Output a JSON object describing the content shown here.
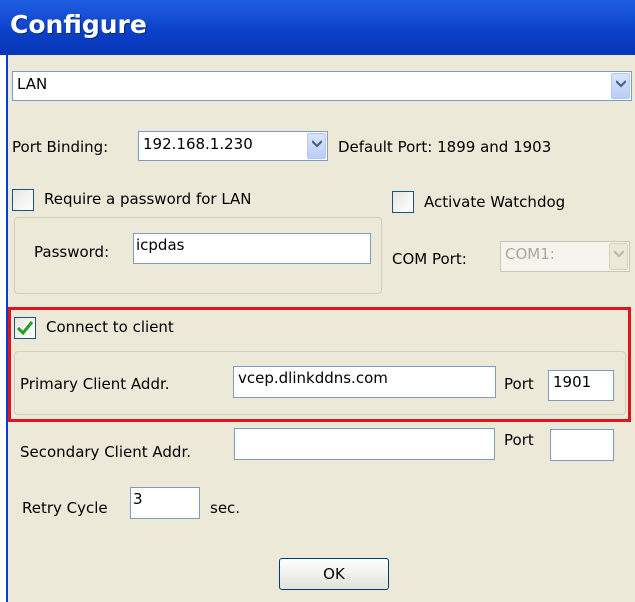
{
  "window": {
    "title": "Configure"
  },
  "connection_type": {
    "value": "LAN"
  },
  "port_binding": {
    "label": "Port Binding:",
    "value": "192.168.1.230",
    "default_port_text": "Default Port: 1899 and 1903"
  },
  "password": {
    "require_label": "Require a password for LAN",
    "require_checked": false,
    "label": "Password:",
    "value": "icpdas"
  },
  "watchdog": {
    "label": "Activate Watchdog",
    "checked": false,
    "com_label": "COM Port:",
    "com_value": "COM1:"
  },
  "client": {
    "connect_label": "Connect to client",
    "connect_checked": true,
    "primary_label": "Primary Client Addr.",
    "primary_value": "vcep.dlinkddns.com",
    "primary_port_label": "Port",
    "primary_port_value": "1901",
    "secondary_label": "Secondary Client Addr.",
    "secondary_value": "",
    "secondary_port_label": "Port",
    "secondary_port_value": "",
    "retry_label": "Retry Cycle",
    "retry_value": "3",
    "retry_unit": "sec."
  },
  "ok_button": {
    "label": "OK"
  },
  "colors": {
    "title_bar": "#0a3fc8",
    "dialog_bg": "#ece9d8",
    "highlight": "#e2141b",
    "check_green": "#21a121"
  }
}
